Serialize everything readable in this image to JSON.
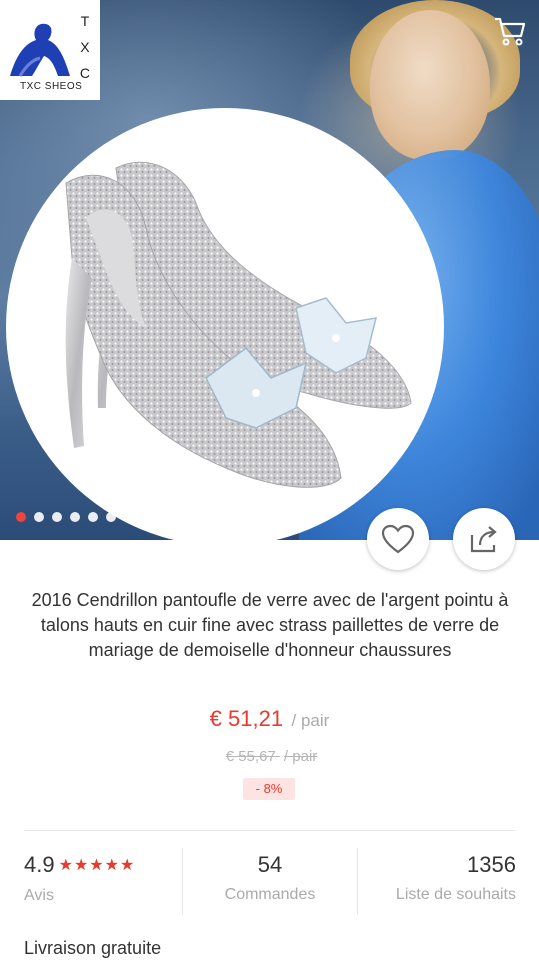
{
  "logo": {
    "letters": [
      "T",
      "X",
      "C"
    ],
    "text": "TXC SHEOS"
  },
  "hero": {
    "dots_total": 6,
    "active_dot": 0
  },
  "product": {
    "title": "2016 Cendrillon pantoufle de verre avec de l'argent pointu à talons hauts en cuir fine avec strass paillettes de verre de mariage de demoiselle d'honneur chaussures",
    "price": "€ 51,21",
    "price_unit": "/ pair",
    "old_price": "€ 55,67",
    "old_price_unit": "/ pair",
    "discount": "- 8%"
  },
  "stats": {
    "rating": "4.9",
    "stars": "★★★★★",
    "rating_label": "Avis",
    "orders": "54",
    "orders_label": "Commandes",
    "wishlist": "1356",
    "wishlist_label": "Liste de souhaits"
  },
  "shipping": {
    "label": "Livraison gratuite"
  },
  "colors": {
    "accent": "#e63b2e",
    "muted": "#aaaaaa",
    "discount_bg": "#fde3e1"
  }
}
